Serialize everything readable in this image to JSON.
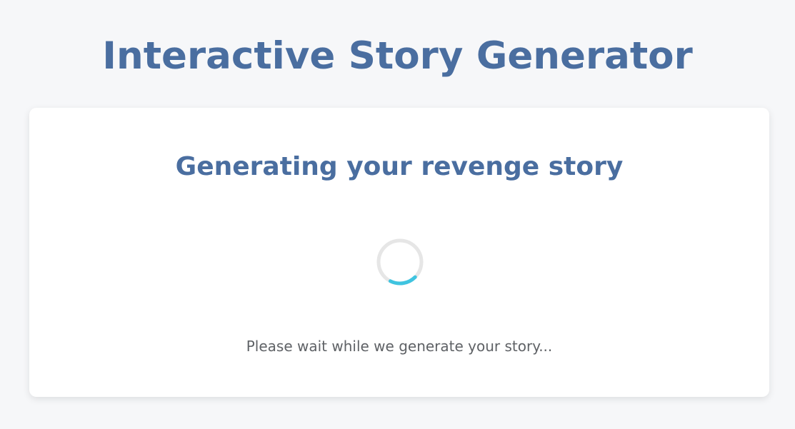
{
  "header": {
    "title": "Interactive Story Generator"
  },
  "card": {
    "heading": "Generating your revenge story",
    "status": "Please wait while we generate your story..."
  },
  "spinner": {
    "icon": "loading-spinner-icon",
    "track_color": "#e6e6e6",
    "arc_color": "#3fc4e0"
  },
  "colors": {
    "accent": "#4a6ea0",
    "background": "#f6f7f9",
    "card": "#ffffff",
    "text_muted": "#5f6266"
  }
}
